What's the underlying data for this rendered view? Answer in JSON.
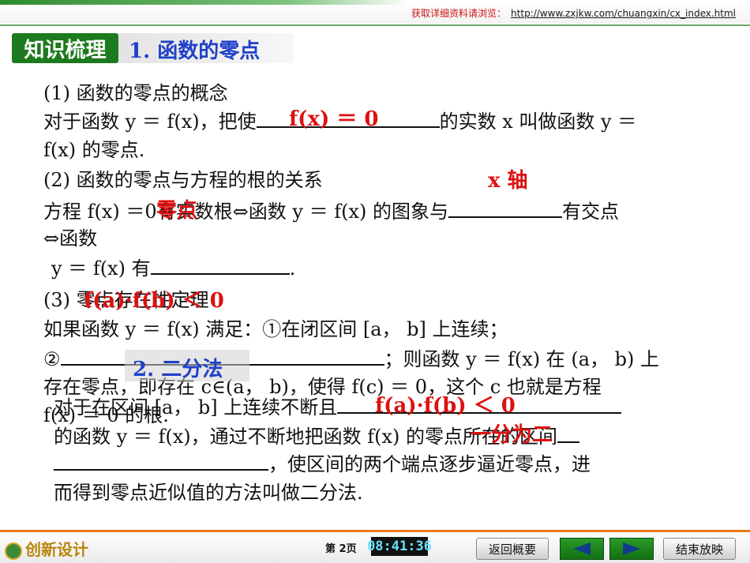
{
  "header": {
    "label": "获取详细资料请浏览：",
    "url": "http://www.zxjkw.com/chuangxin/cx_index.html"
  },
  "section": {
    "tag": "知识梳理",
    "title": "1. 函数的零点"
  },
  "content": {
    "p1": "(1) 函数的零点的概念",
    "p2a": "对于函数 y ＝ f(x)，把使",
    "p2b": "的实数 x 叫做函数 y ＝",
    "p3": "f(x) 的零点.",
    "p4": "(2) 函数的零点与方程的根的关系",
    "p5a": "方程 f(x) ＝0有实数根⇔函数 y ＝ f(x) 的图象与",
    "p5b": "有交点",
    "p6": "⇔函数",
    "p7a": "y ＝ f(x) 有",
    "p7b": ".",
    "p8": "(3) 零点存在性定理",
    "p9": "如果函数 y ＝ f(x) 满足：①在闭区间 [a， b] 上连续；",
    "p10a": "②",
    "p10b": "；则函数 y ＝ f(x) 在 (a， b) 上",
    "p11": "存在零点，即存在 c∈(a， b)，使得 f(c) ＝ 0，这个 c 也就是方程",
    "p12": "f(x) ＝ 0 的根.",
    "q1": "对于在区间 [a， b] 上连续不断且",
    "q2a": "的函数 y ＝ f(x)，通过不断地把函数 f(x) 的零点所在的区间",
    "q3": "，使区间的两个端点逐步逼近零点，进",
    "q4": "而得到零点近似值的方法叫做二分法."
  },
  "answers": {
    "a1": "f(x) ＝ 0",
    "a2": "x 轴",
    "a3": "零点",
    "a4": "f(a)·f(b) ＜ 0",
    "a5": "f(a)·f(b) ＜ 0",
    "a6": "一分为二"
  },
  "subsection": {
    "title": "2. 二分法"
  },
  "footer": {
    "logo": "创新设计",
    "page": "第 2页",
    "clock": "08:41:36",
    "back_label": "返回概要",
    "end_label": "结束放映"
  }
}
